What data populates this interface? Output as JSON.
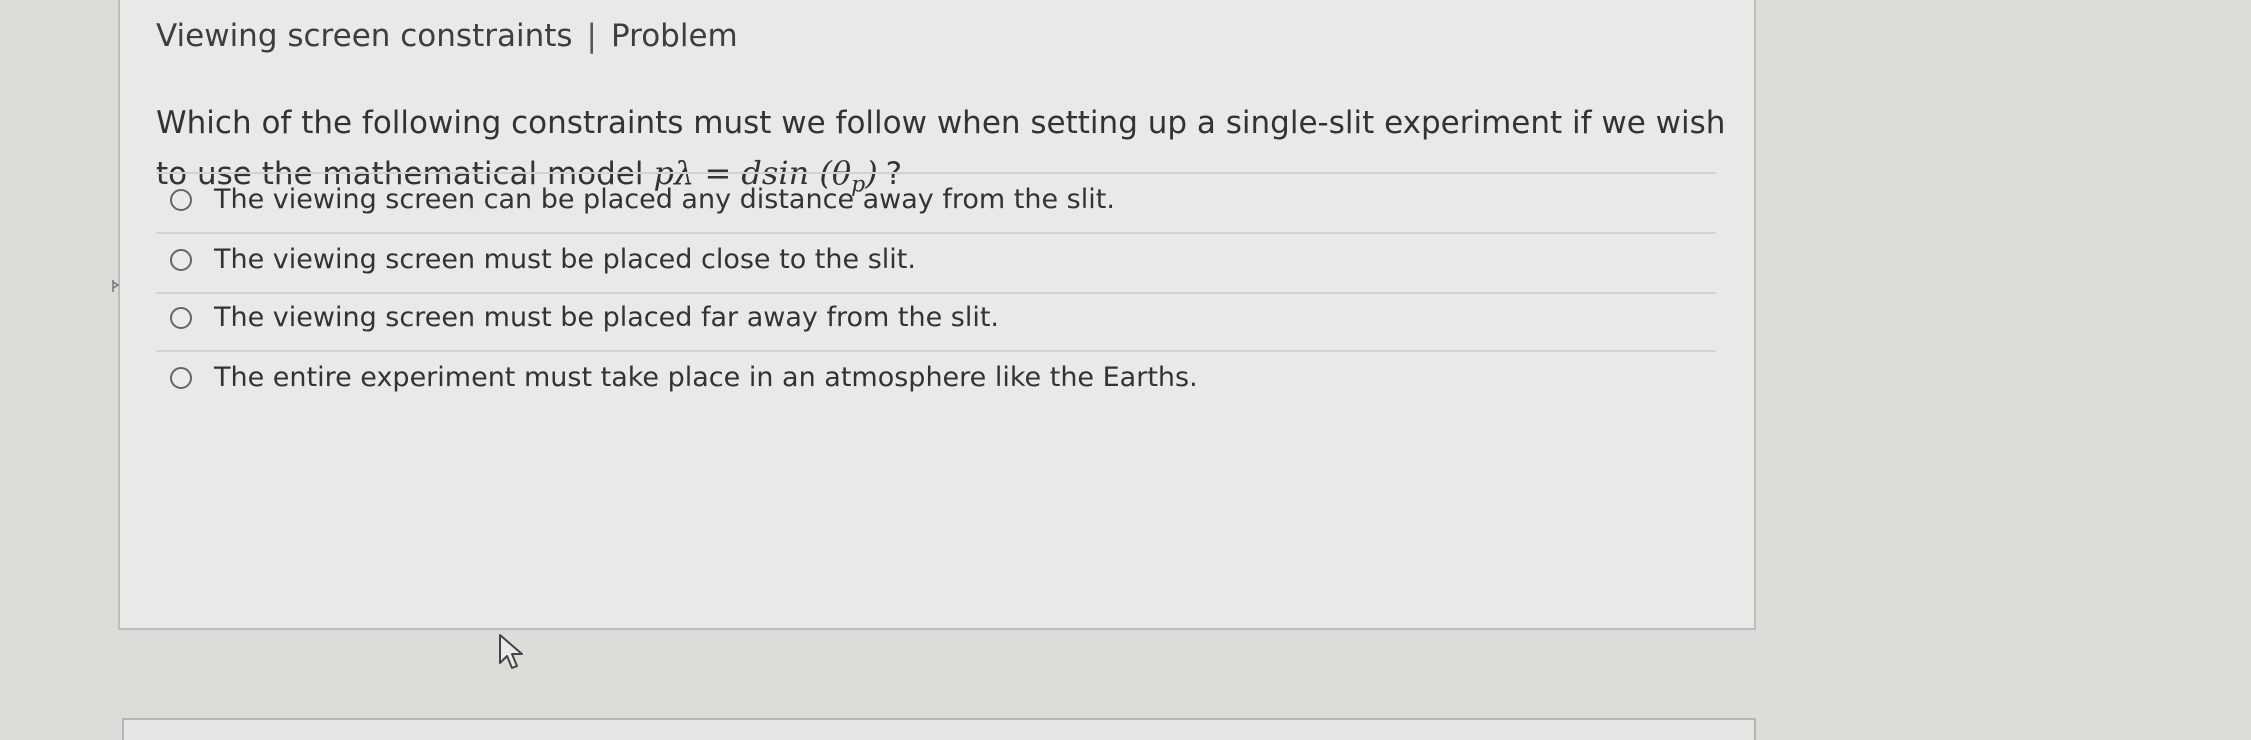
{
  "question": {
    "title_main": "Viewing screen constraints",
    "title_sep": "|",
    "title_section": "Problem",
    "prompt_line1": "Which of the following constraints must we follow when setting up a single-slit experiment if we wish",
    "prompt_line2_text": "to use the mathematical model",
    "formula_lhs": "pλ = dsin (θ",
    "formula_sub": "p",
    "formula_close": ")",
    "prompt_end": "?"
  },
  "options": [
    {
      "label": "The viewing screen can be placed any distance away from the slit.",
      "selected": false
    },
    {
      "label": "The viewing screen must be placed close to the slit.",
      "selected": false
    },
    {
      "label": "The viewing screen must be placed far away from the slit.",
      "selected": false
    },
    {
      "label": "The entire experiment must take place in an atmosphere like the Earths.",
      "selected": false
    }
  ],
  "icons": {
    "radio": "radio-button-icon",
    "cursor": "mouse-pointer-icon"
  },
  "colors": {
    "background": "#dcdcd9",
    "card": "#e9e9e7",
    "text": "#333333",
    "border": "#bdbdba"
  }
}
